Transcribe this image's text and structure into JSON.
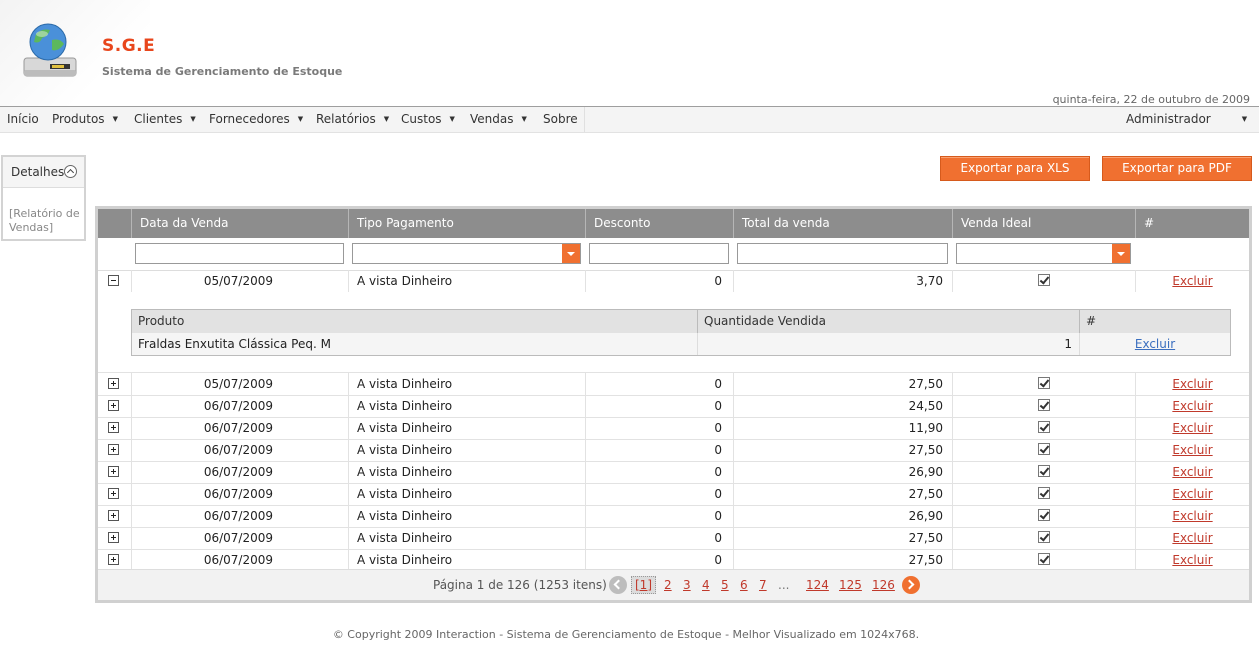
{
  "app": {
    "title": "S.G.E",
    "subtitle": "Sistema de Gerenciamento de Estoque",
    "date": "quinta-feira, 22 de outubro de 2009"
  },
  "menu": {
    "items": [
      {
        "label": "Início",
        "dropdown": false
      },
      {
        "label": "Produtos",
        "dropdown": true
      },
      {
        "label": "Clientes",
        "dropdown": true
      },
      {
        "label": "Fornecedores",
        "dropdown": true
      },
      {
        "label": "Relatórios",
        "dropdown": true
      },
      {
        "label": "Custos",
        "dropdown": true
      },
      {
        "label": "Vendas",
        "dropdown": true
      },
      {
        "label": "Sobre",
        "dropdown": false
      }
    ],
    "user": "Administrador"
  },
  "left_panel": {
    "title": "Detalhes",
    "link": "[Relatório de Vendas]"
  },
  "export": {
    "xls": "Exportar para XLS",
    "pdf": "Exportar para PDF"
  },
  "grid": {
    "columns": [
      "Data da Venda",
      "Tipo Pagamento",
      "Desconto",
      "Total da venda",
      "Venda Ideal",
      "#"
    ],
    "first_row": {
      "date": "05/07/2009",
      "payment": "A vista Dinheiro",
      "discount": "0",
      "total": "3,70",
      "ideal": true,
      "action": "Excluir"
    },
    "detail": {
      "columns": [
        "Produto",
        "Quantidade Vendida",
        "#"
      ],
      "rows": [
        {
          "product": "Fraldas Enxutita Clássica Peq. M",
          "qty": "1",
          "action": "Excluir"
        }
      ]
    },
    "rows": [
      {
        "date": "05/07/2009",
        "payment": "A vista Dinheiro",
        "discount": "0",
        "total": "27,50",
        "ideal": true,
        "action": "Excluir"
      },
      {
        "date": "06/07/2009",
        "payment": "A vista Dinheiro",
        "discount": "0",
        "total": "24,50",
        "ideal": true,
        "action": "Excluir"
      },
      {
        "date": "06/07/2009",
        "payment": "A vista Dinheiro",
        "discount": "0",
        "total": "11,90",
        "ideal": true,
        "action": "Excluir"
      },
      {
        "date": "06/07/2009",
        "payment": "A vista Dinheiro",
        "discount": "0",
        "total": "27,50",
        "ideal": true,
        "action": "Excluir"
      },
      {
        "date": "06/07/2009",
        "payment": "A vista Dinheiro",
        "discount": "0",
        "total": "26,90",
        "ideal": true,
        "action": "Excluir"
      },
      {
        "date": "06/07/2009",
        "payment": "A vista Dinheiro",
        "discount": "0",
        "total": "27,50",
        "ideal": true,
        "action": "Excluir"
      },
      {
        "date": "06/07/2009",
        "payment": "A vista Dinheiro",
        "discount": "0",
        "total": "26,90",
        "ideal": true,
        "action": "Excluir"
      },
      {
        "date": "06/07/2009",
        "payment": "A vista Dinheiro",
        "discount": "0",
        "total": "27,50",
        "ideal": true,
        "action": "Excluir"
      },
      {
        "date": "06/07/2009",
        "payment": "A vista Dinheiro",
        "discount": "0",
        "total": "27,50",
        "ideal": true,
        "action": "Excluir"
      }
    ],
    "pager": {
      "info": "Página 1 de 126 (1253 itens)",
      "current": "[1]",
      "pages": [
        "2",
        "3",
        "4",
        "5",
        "6",
        "7"
      ],
      "ellipsis": "...",
      "last_pages": [
        "124",
        "125",
        "126"
      ]
    }
  },
  "footer": "© Copyright 2009 Interaction - Sistema de Gerenciamento de Estoque - Melhor Visualizado em 1024x768.",
  "colors": {
    "accent": "#f07030",
    "title": "#e8461c",
    "header_bg": "#8d8d8d",
    "link": "#c0392b",
    "link_blue": "#3b6fbf"
  }
}
